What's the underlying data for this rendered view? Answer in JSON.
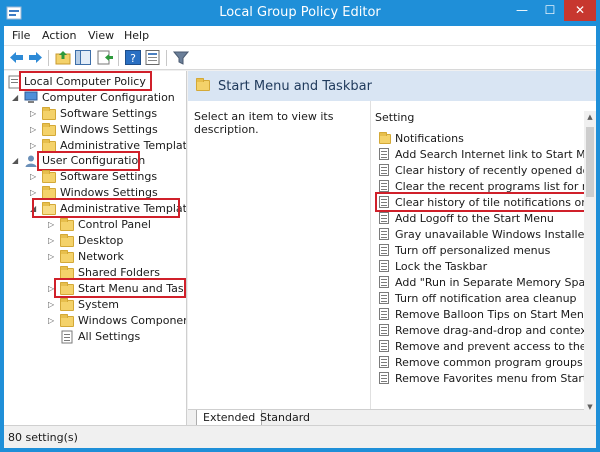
{
  "window": {
    "title": "Local Group Policy Editor",
    "min_glyph": "—",
    "max_glyph": "☐",
    "close_glyph": "✕"
  },
  "menu": [
    "File",
    "Action",
    "View",
    "Help"
  ],
  "toolbar": {
    "icons": [
      "back-arrow-icon",
      "forward-arrow-icon",
      "up-folder-icon",
      "show-hide-tree-icon",
      "export-list-icon",
      "help-icon",
      "properties-icon",
      "filter-icon"
    ]
  },
  "tree": {
    "root": "Local Computer Policy",
    "computer_configuration": "Computer Configuration",
    "cc_software": "Software Settings",
    "cc_windows": "Windows Settings",
    "cc_admin": "Administrative Templates",
    "user_configuration": "User Configuration",
    "uc_software": "Software Settings",
    "uc_windows": "Windows Settings",
    "uc_admin": "Administrative Templates",
    "control_panel": "Control Panel",
    "desktop": "Desktop",
    "network": "Network",
    "shared_folders": "Shared Folders",
    "start_menu": "Start Menu and Taskbar",
    "system": "System",
    "windows_components": "Windows Components",
    "all_settings": "All Settings"
  },
  "right": {
    "header_title": "Start Menu and Taskbar",
    "description": "Select an item to view its description.",
    "column": "Setting",
    "items": [
      "Notifications",
      "Add Search Internet link to Start Menu",
      "Clear history of recently opened docume",
      "Clear the recent programs list for new us",
      "Clear history of tile notifications on exit",
      "Add Logoff to the Start Menu",
      "Gray unavailable Windows Installer prog",
      "Turn off personalized menus",
      "Lock the Taskbar",
      "Add \"Run in Separate Memory Space\" ch",
      "Turn off notification area cleanup",
      "Remove Balloon Tips on Start Menu iten",
      "Remove drag-and-drop and context me",
      "Remove and prevent access to the Shut",
      "Remove common program groups from",
      "Remove Favorites menu from Start Men"
    ]
  },
  "tabs": {
    "extended": "Extended",
    "standard": "Standard"
  },
  "status": "80 setting(s)",
  "colors": {
    "titlebar": "#1f8fd8",
    "highlight_box": "#d0202a",
    "header_band": "#d9e5f3",
    "folder": "#f4d26a"
  }
}
